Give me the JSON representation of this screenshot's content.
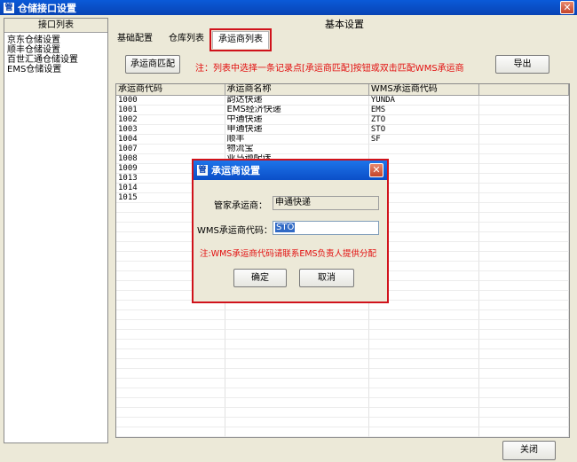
{
  "window": {
    "title": "仓储接口设置",
    "close_glyph": "✕",
    "icon_glyph": "管"
  },
  "sidebar": {
    "header": "接口列表",
    "items": [
      {
        "label": "京东仓储设置"
      },
      {
        "label": "顺丰仓储设置"
      },
      {
        "label": "百世汇通仓储设置"
      },
      {
        "label": "EMS仓储设置"
      }
    ]
  },
  "main": {
    "title": "基本设置",
    "tabs": [
      {
        "label": "基础配置"
      },
      {
        "label": "仓库列表"
      },
      {
        "label": "承运商列表",
        "active": true
      }
    ],
    "match_button": "承运商匹配",
    "hint": "注：列表中选择一条记录点[承运商匹配]按钮或双击匹配WMS承运商",
    "export_button": "导出",
    "close_button": "关闭"
  },
  "grid": {
    "columns": [
      "承运商代码",
      "承运商名称",
      "WMS承运商代码",
      ""
    ],
    "rows": [
      [
        "1000",
        "韵达快递",
        "YUNDA"
      ],
      [
        "1001",
        "EMS经济快递",
        "EMS"
      ],
      [
        "1002",
        "中通快递",
        "ZTO"
      ],
      [
        "1003",
        "申通快递",
        "STO"
      ],
      [
        "1004",
        "顺丰",
        "SF"
      ],
      [
        "1007",
        "物流宝",
        ""
      ],
      [
        "1008",
        "亚马逊配送",
        ""
      ],
      [
        "1009",
        "",
        ""
      ],
      [
        "1013",
        "",
        ""
      ],
      [
        "1014",
        "",
        ""
      ],
      [
        "1015",
        "",
        ""
      ]
    ]
  },
  "dialog": {
    "title": "承运商设置",
    "close_glyph": "✕",
    "icon_glyph": "管",
    "carrier_label": "管家承运商：",
    "carrier_value": "申通快递",
    "wms_label": "WMS承运商代码：",
    "wms_value": "STO",
    "note": "注:WMS承运商代码请联系EMS负责人提供分配",
    "ok_button": "确定",
    "cancel_button": "取消"
  },
  "colors": {
    "title_blue": "#0843b4",
    "highlight_red": "#d0121b",
    "hint_red": "#e20d0d",
    "face": "#ece9d8"
  }
}
